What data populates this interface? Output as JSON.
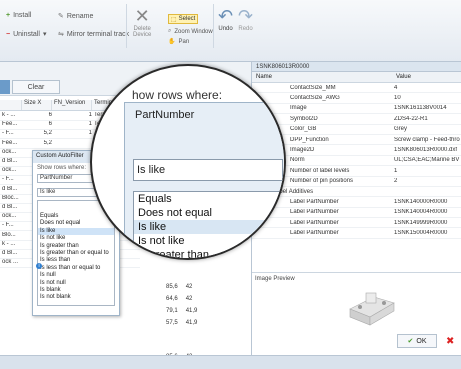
{
  "ribbon": {
    "install": "Install",
    "uninstall": "Uninstall",
    "rename": "Rename",
    "mirror_terminal_track": "Mirror terminal track",
    "delete_device": "Delete\nDevice",
    "select": "Select",
    "zoom_window": "Zoom Window",
    "pan": "Pan",
    "undo": "Undo",
    "redo": "Redo"
  },
  "left": {
    "clear_label": "Clear",
    "columns": [
      "Size X",
      "FN_Version",
      "Termin"
    ],
    "rows": [
      {
        "a": "k - ...",
        "b": "6",
        "c": "1",
        "d": "Term"
      },
      {
        "a": "Fee...",
        "b": "6",
        "c": "1",
        "d": "Term"
      },
      {
        "a": "- F...",
        "b": "5,2",
        "c": "1",
        "d": "Term"
      },
      {
        "a": "Fee...",
        "b": "5,2",
        "c": "",
        "d": ""
      },
      {
        "a": "ock...",
        "b": "",
        "c": "",
        "d": ""
      },
      {
        "a": "d Bl...",
        "b": "",
        "c": "",
        "d": ""
      },
      {
        "a": "ock...",
        "b": "",
        "c": "",
        "d": ""
      },
      {
        "a": "- F...",
        "b": "",
        "c": "",
        "d": ""
      },
      {
        "a": "d Bl...",
        "b": "",
        "c": "",
        "d": ""
      },
      {
        "a": "Bloc...",
        "b": "",
        "c": "",
        "d": ""
      },
      {
        "a": "d Bl...",
        "b": "",
        "c": "",
        "d": ""
      },
      {
        "a": "ock...",
        "b": "",
        "c": "",
        "d": ""
      },
      {
        "a": "- F...",
        "b": "",
        "c": "",
        "d": ""
      },
      {
        "a": "Blo...",
        "b": "",
        "c": "",
        "d": ""
      },
      {
        "a": "k - ...",
        "b": "",
        "c": "",
        "d": ""
      },
      {
        "a": "d Bl...",
        "b": "",
        "c": "",
        "d": ""
      },
      {
        "a": "ock ...",
        "b": "",
        "c": "",
        "d": ""
      }
    ],
    "bottom_values": [
      {
        "a": "85,6",
        "b": "42"
      },
      {
        "a": "64,6",
        "b": "42"
      },
      {
        "a": "79,1",
        "b": "41,9"
      },
      {
        "a": "57,5",
        "b": "41,9"
      }
    ]
  },
  "small_dialog": {
    "title": "Custom AutoFilter",
    "show_rows": "Show rows where:",
    "field": "PartNumber",
    "current": "Is like",
    "options": [
      "Equals",
      "Does not equal",
      "Is like",
      "Is not like",
      "Is greater than",
      "Is greater than or equal to",
      "Is less than",
      "Is less than or equal to",
      "Is null",
      "Is not null",
      "Is blank",
      "Is not blank"
    ],
    "selected_index": 2
  },
  "magnifier": {
    "title": "how rows where:",
    "field": "PartNumber",
    "current": "Is like",
    "options": [
      "Equals",
      "Does not equal",
      "Is like",
      "Is not like",
      "Is greater than",
      "Is greater than or equal",
      "Is less than",
      "Is less than"
    ],
    "selected_index": 2
  },
  "right": {
    "header": "1SNK806013R0000",
    "col_name": "Name",
    "col_value": "Value",
    "properties": [
      {
        "name": "ContactSize_MM",
        "value": "4"
      },
      {
        "name": "ContactSize_AWG",
        "value": "10"
      },
      {
        "name": "Image",
        "value": "1SNK161138V0014"
      },
      {
        "name": "Symbol2D",
        "value": "ZDS4-22-R1"
      },
      {
        "name": "Color_GB",
        "value": "Grey"
      },
      {
        "name": "DPP_Function",
        "value": "Screw clamp - Feed-thro"
      },
      {
        "name": "Image2D",
        "value": "1SNK806013R0000.dxf"
      },
      {
        "name": "Norm",
        "value": "UL;CSA;EAC;Marine BV"
      },
      {
        "name": "Number of label levels",
        "value": "1"
      },
      {
        "name": "Number of pin positions",
        "value": "2"
      }
    ],
    "group_label": "Label Additives",
    "label_rows": [
      {
        "name": "Label PartNumber",
        "value": "1SNK140000R0000"
      },
      {
        "name": "Label PartNumber",
        "value": "1SNK140004R0000"
      },
      {
        "name": "Label PartNumber",
        "value": "1SNK149999R0000"
      },
      {
        "name": "Label PartNumber",
        "value": "1SNK150004R0000"
      }
    ],
    "image_preview": "Image Preview",
    "ok_label": "OK"
  }
}
